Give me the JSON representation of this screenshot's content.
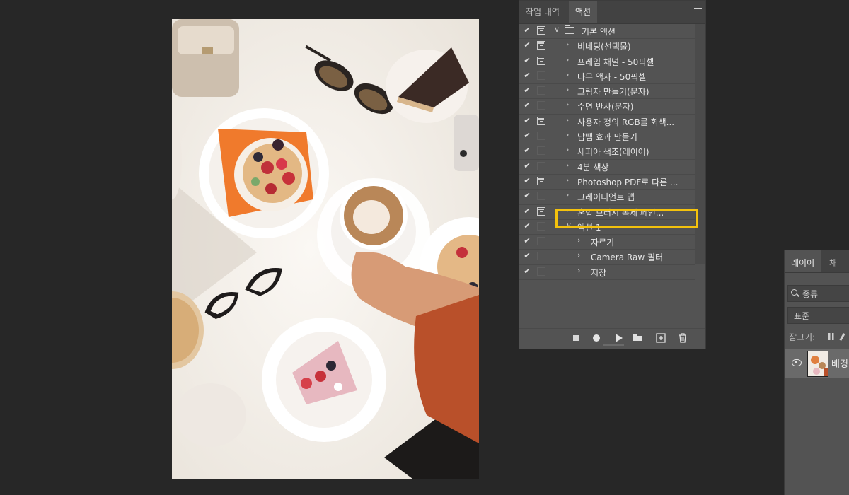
{
  "actions_panel": {
    "tabs": [
      "작업 내역",
      "액션"
    ],
    "active_tab": "액션",
    "rows": [
      {
        "checked": true,
        "dialog": true,
        "level": 0,
        "expanded": true,
        "folder": true,
        "label": "기본 액션"
      },
      {
        "checked": true,
        "dialog": true,
        "level": 1,
        "expanded": false,
        "folder": false,
        "label": "비네팅(선택물)"
      },
      {
        "checked": true,
        "dialog": true,
        "level": 1,
        "expanded": false,
        "folder": false,
        "label": "프레임 채널 - 50픽셀"
      },
      {
        "checked": true,
        "dialog": false,
        "level": 1,
        "expanded": false,
        "folder": false,
        "label": "나무 액자 - 50픽셀"
      },
      {
        "checked": true,
        "dialog": false,
        "level": 1,
        "expanded": false,
        "folder": false,
        "label": "그림자 만들기(문자)"
      },
      {
        "checked": true,
        "dialog": false,
        "level": 1,
        "expanded": false,
        "folder": false,
        "label": "수면 반사(문자)"
      },
      {
        "checked": true,
        "dialog": true,
        "level": 1,
        "expanded": false,
        "folder": false,
        "label": "사용자 정의 RGB를 회색..."
      },
      {
        "checked": true,
        "dialog": false,
        "level": 1,
        "expanded": false,
        "folder": false,
        "label": "납땜 효과 만들기"
      },
      {
        "checked": true,
        "dialog": false,
        "level": 1,
        "expanded": false,
        "folder": false,
        "label": "세피아 색조(레이어)"
      },
      {
        "checked": true,
        "dialog": false,
        "level": 1,
        "expanded": false,
        "folder": false,
        "label": "4분 색상"
      },
      {
        "checked": true,
        "dialog": true,
        "level": 1,
        "expanded": false,
        "folder": false,
        "label": "Photoshop PDF로 다른 ..."
      },
      {
        "checked": true,
        "dialog": false,
        "level": 1,
        "expanded": false,
        "folder": false,
        "label": "그레이디언트 맵"
      },
      {
        "checked": true,
        "dialog": true,
        "level": 1,
        "expanded": false,
        "folder": false,
        "label": "혼합 브러시 복제 페인..."
      },
      {
        "checked": true,
        "dialog": false,
        "level": 1,
        "expanded": true,
        "folder": false,
        "label": "액션 1"
      },
      {
        "checked": true,
        "dialog": false,
        "level": 2,
        "expanded": false,
        "folder": false,
        "label": "자르기"
      },
      {
        "checked": true,
        "dialog": false,
        "level": 2,
        "expanded": false,
        "folder": false,
        "label": "Camera Raw 필터"
      },
      {
        "checked": true,
        "dialog": false,
        "level": 2,
        "expanded": false,
        "folder": false,
        "label": "저장"
      }
    ],
    "toolbar": [
      "stop-icon",
      "record-icon",
      "play-icon",
      "folder-icon",
      "new-action-icon",
      "trash-icon"
    ]
  },
  "layers_panel": {
    "tabs": [
      "레이어",
      "채널"
    ],
    "active_tab": "레이어",
    "filter_label": "종류",
    "blend_mode": "표준",
    "lock_label": "잠그기:",
    "layer_name": "배경"
  },
  "colors": {
    "highlight": "#f4c20d",
    "panel_bg": "#535353",
    "app_bg": "#272727"
  }
}
